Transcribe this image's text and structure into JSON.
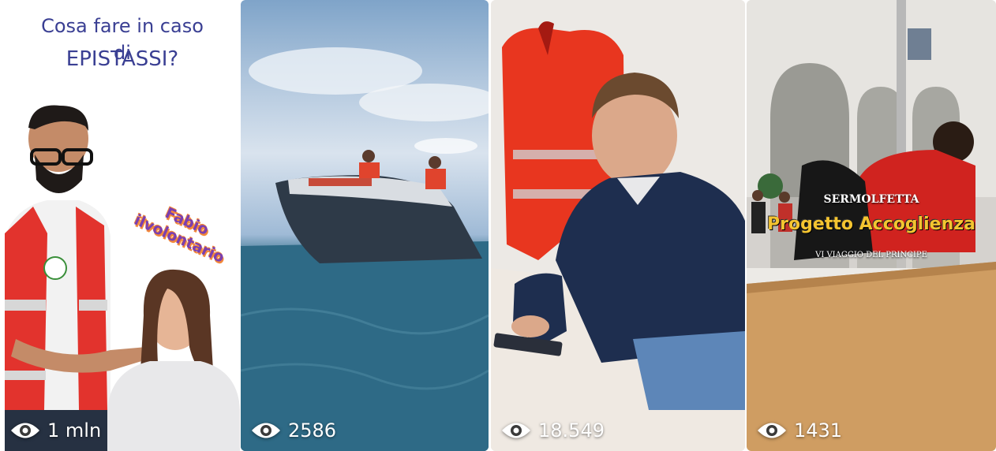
{
  "reels": [
    {
      "title_line1": "Cosa fare in caso di",
      "title_line2": "EPISTASSI?",
      "tag_line1": "Fabio",
      "tag_line2": "ilvolontario",
      "views": "1 mln"
    },
    {
      "views": "2586"
    },
    {
      "views": "18.549"
    },
    {
      "org": "SERMOLFETTA",
      "project": "Progetto Accoglienza",
      "subtitle": "VI VIAGGIO DEL PRINCIPE",
      "views": "1431"
    }
  ],
  "icons": {
    "view_count": "eye-icon"
  },
  "colors": {
    "title_text": "#3a3f93",
    "tag_text": "#7a3fb0",
    "tag_outline": "#f3883a",
    "project_text": "#f4c430",
    "views_text": "#ffffff"
  }
}
